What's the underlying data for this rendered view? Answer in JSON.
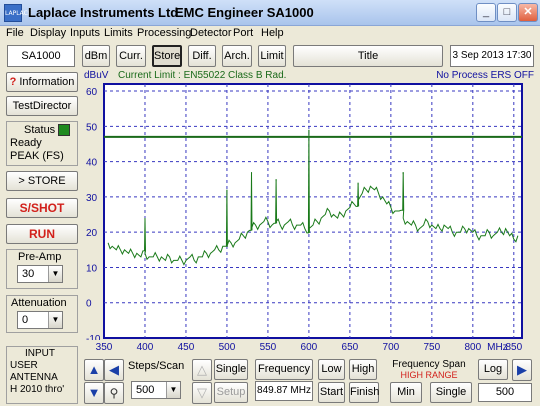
{
  "window": {
    "title": "Laplace Instruments Ltd",
    "app": "EMC Engineer SA1000",
    "icon_text": "LAPLACE"
  },
  "menu": [
    "File",
    "Display",
    "Inputs",
    "Limits",
    "Processing",
    "Detector",
    "Port",
    "Help"
  ],
  "toolbar": {
    "model": "SA1000",
    "buttons": [
      "dBm",
      "Curr.",
      "Store",
      "Diff.",
      "Arch.",
      "Limit"
    ],
    "pressed": "Store",
    "title_button": "Title",
    "date": "3 Sep 2013 17:30"
  },
  "left": {
    "information": "Information",
    "info_glyph": "?",
    "testdirector": "TestDirector",
    "status_label": "Status",
    "status_lines": [
      "Ready",
      "PEAK (FS)"
    ],
    "store": "> STORE",
    "sshot": "S/SHOT",
    "run": "RUN",
    "preamp_label": "Pre-Amp",
    "preamp_value": "30",
    "atten_label": "Attenuation",
    "atten_value": "0",
    "input_lines": [
      "INPUT",
      "USER",
      "ANTENNA",
      "H 2010 thro'"
    ]
  },
  "chart_head": {
    "unit": "dBuV",
    "limit": "Current Limit : EN55022 Class B Rad.",
    "process": "No Process ERS OFF",
    "x_unit": "MHz"
  },
  "chart_data": {
    "type": "line",
    "ylabel": "dBuV",
    "xlabel": "MHz",
    "xlim": [
      350,
      860
    ],
    "ylim": [
      -10,
      62
    ],
    "xticks": [
      350,
      400,
      450,
      500,
      550,
      600,
      650,
      700,
      750,
      800,
      850
    ],
    "yticks": [
      60,
      50,
      40,
      30,
      20,
      10,
      0,
      -10
    ],
    "grid": true,
    "limit_line": {
      "name": "EN55022 Class B Rad.",
      "value": 47
    },
    "series": [
      {
        "x": [
          355,
          360,
          365,
          370,
          375,
          380,
          385,
          390,
          395,
          400,
          405,
          410,
          415,
          420,
          425,
          430,
          435,
          440,
          445,
          450,
          455,
          460,
          465,
          470,
          475,
          480,
          485,
          490,
          495,
          500,
          505,
          510,
          515,
          520,
          525,
          530,
          535,
          540,
          545,
          550,
          555,
          560,
          565,
          570,
          575,
          580,
          585,
          590,
          595,
          600,
          605,
          610,
          615,
          620,
          625,
          630,
          635,
          640,
          645,
          650,
          655,
          660,
          665,
          670,
          675,
          680,
          685,
          690,
          695,
          700,
          705,
          710,
          715,
          720,
          725,
          730,
          735,
          740,
          745,
          750,
          755,
          760,
          765,
          770,
          775,
          780,
          785,
          790,
          795,
          800,
          805,
          810,
          815,
          820,
          825,
          830,
          835,
          840,
          845,
          850,
          855
        ],
        "y": [
          17,
          16,
          15,
          15,
          15,
          14,
          14,
          14,
          13,
          14,
          13,
          13,
          13,
          13,
          12,
          13,
          12,
          12,
          12,
          12,
          13,
          12,
          13,
          13,
          14,
          14,
          15,
          15,
          16,
          16,
          17,
          17,
          18,
          19,
          20,
          21,
          22,
          22,
          23,
          23,
          22,
          23,
          22,
          22,
          23,
          22,
          22,
          22,
          21,
          21,
          22,
          23,
          24,
          25,
          26,
          25,
          24,
          25,
          26,
          27,
          28,
          29,
          31,
          32,
          33,
          32,
          31,
          30,
          28,
          27,
          26,
          26,
          24,
          23,
          22,
          22,
          21,
          22,
          23,
          22,
          21,
          21,
          22,
          21,
          20,
          20,
          20,
          21,
          21,
          20,
          19,
          19,
          19,
          20,
          19,
          20,
          20,
          21,
          19,
          18,
          19
        ]
      }
    ],
    "spikes": [
      {
        "x": 400,
        "y": 24
      },
      {
        "x": 500,
        "y": 32
      },
      {
        "x": 530,
        "y": 37
      },
      {
        "x": 560,
        "y": 35
      },
      {
        "x": 600,
        "y": 49
      },
      {
        "x": 660,
        "y": 34
      },
      {
        "x": 715,
        "y": 37
      }
    ]
  },
  "bottom": {
    "steps_label": "Steps/Scan",
    "steps_value": "500",
    "single": "Single",
    "setup": "Setup",
    "freq_label": "Frequency",
    "freq_value": "849.87 MHz",
    "low": "Low",
    "high": "High",
    "start": "Start",
    "finish": "Finish",
    "span_label": "Frequency Span",
    "span_value": "HIGH RANGE",
    "min": "Min",
    "single2": "Single",
    "log": "Log",
    "log_value": "500"
  },
  "colors": {
    "trace": "#1a7a1a",
    "limit": "#1a6a1a",
    "axis": "#1010a0",
    "grid": "#3838c0",
    "red": "#d2201b",
    "status_led": "#1f8a1f"
  }
}
